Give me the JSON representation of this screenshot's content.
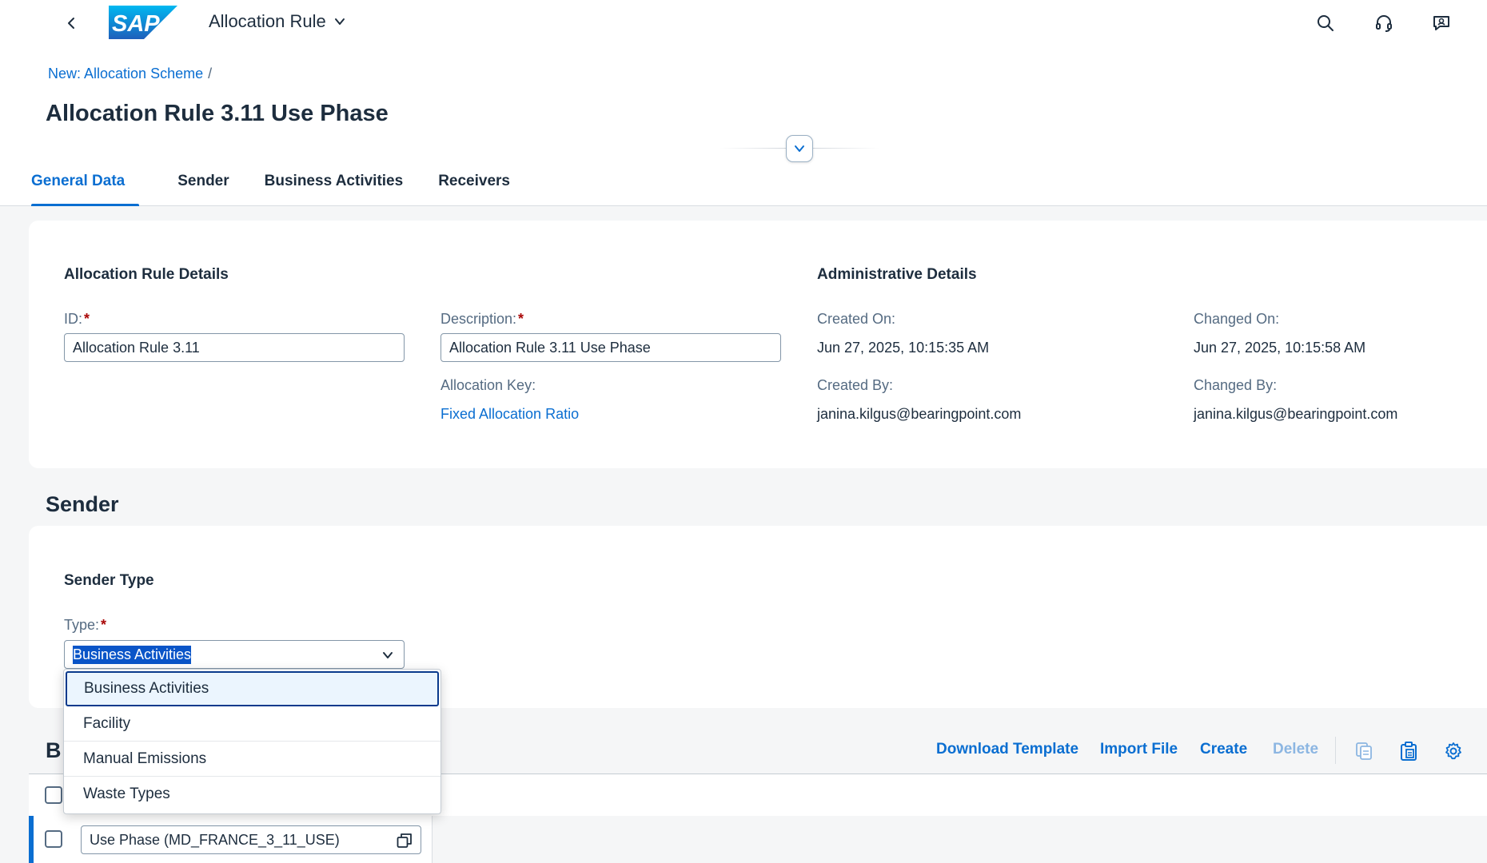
{
  "shell": {
    "logo_text": "SAP",
    "app_title": "Allocation Rule",
    "icons": [
      "back-icon",
      "search-icon",
      "headset-icon",
      "notifications-icon"
    ]
  },
  "breadcrumb": {
    "link": "New: Allocation Scheme",
    "separator": "/"
  },
  "page_title": "Allocation Rule 3.11 Use Phase",
  "tabs": [
    {
      "label": "General Data",
      "active": true
    },
    {
      "label": "Sender",
      "active": false
    },
    {
      "label": "Business Activities",
      "active": false
    },
    {
      "label": "Receivers",
      "active": false
    }
  ],
  "rule_details": {
    "title": "Allocation Rule Details",
    "id_label": "ID:",
    "id_value": "Allocation Rule 3.11",
    "description_label": "Description:",
    "description_value": "Allocation Rule 3.11 Use Phase",
    "allocation_key_label": "Allocation Key:",
    "allocation_key_value": "Fixed Allocation Ratio",
    "required_mark": "*"
  },
  "admin_details": {
    "title": "Administrative Details",
    "created_on_label": "Created On:",
    "created_on_value": "Jun 27, 2025, 10:15:35 AM",
    "changed_on_label": "Changed On:",
    "changed_on_value": "Jun 27, 2025, 10:15:58 AM",
    "created_by_label": "Created By:",
    "created_by_value": "janina.kilgus@bearingpoint.com",
    "changed_by_label": "Changed By:",
    "changed_by_value": "janina.kilgus@bearingpoint.com"
  },
  "sender": {
    "section_title": "Sender",
    "sender_type_title": "Sender Type",
    "type_label": "Type:",
    "type_value": "Business Activities",
    "options": [
      "Business Activities",
      "Facility",
      "Manual Emissions",
      "Waste Types"
    ],
    "selected_index": 0
  },
  "activities_table": {
    "title_visible": "B",
    "toolbar": {
      "download_template": "Download Template",
      "import_file": "Import File",
      "create": "Create",
      "delete": "Delete"
    },
    "rows": [
      {
        "value": "Use Phase (MD_FRANCE_3_11_USE)"
      }
    ]
  },
  "colors": {
    "accent": "#0a6ed1",
    "text": "#1d2d3e",
    "label": "#556b82",
    "required": "#aa0808",
    "background": "#f5f6f7"
  }
}
